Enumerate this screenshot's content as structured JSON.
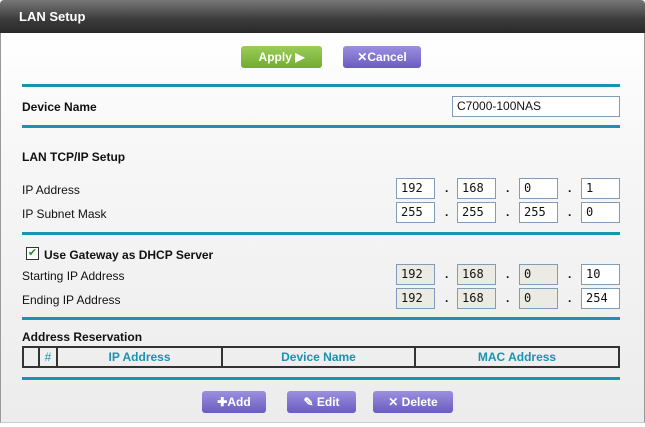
{
  "header": {
    "title": "LAN Setup"
  },
  "toolbar": {
    "apply": "Apply ▶",
    "cancel": "✕Cancel"
  },
  "device_name": {
    "label": "Device Name",
    "value": "C7000-100NAS"
  },
  "lan": {
    "section": "LAN TCP/IP Setup",
    "ip_label": "IP Address",
    "ip": [
      "192",
      "168",
      "0",
      "1"
    ],
    "mask_label": "IP Subnet Mask",
    "mask": [
      "255",
      "255",
      "255",
      "0"
    ]
  },
  "dhcp": {
    "checkbox_label": "Use Gateway as DHCP Server",
    "checked": true,
    "start_label": "Starting IP Address",
    "start": [
      "192",
      "168",
      "0",
      "10"
    ],
    "end_label": "Ending IP Address",
    "end": [
      "192",
      "168",
      "0",
      "254"
    ]
  },
  "reservation": {
    "title": "Address Reservation",
    "columns": [
      "",
      "#",
      "IP Address",
      "Device Name",
      "MAC Address"
    ]
  },
  "actions": {
    "add": "✚Add",
    "edit": "✎ Edit",
    "delete": "✕ Delete"
  }
}
